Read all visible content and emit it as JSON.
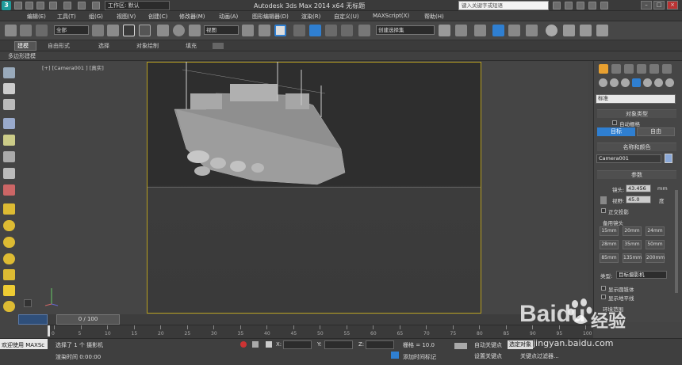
{
  "title_bar": {
    "workspace": "工作区: 默认",
    "title": "Autodesk 3ds Max  2014 x64      无标题",
    "search_placeholder": "键入关键字或短语"
  },
  "menus": [
    "编辑(E)",
    "工具(T)",
    "组(G)",
    "视图(V)",
    "创建(C)",
    "修改器(M)",
    "动画(A)",
    "图形编辑器(D)",
    "渲染(R)",
    "自定义(U)",
    "MAXScript(X)",
    "帮助(H)"
  ],
  "toolbar": {
    "selection_filter": "全部",
    "reference_coord": "视图",
    "named_selection": "创建选择集"
  },
  "ribbon": {
    "tabs": [
      "建模",
      "自由形式",
      "选择",
      "对象绘制",
      "填充"
    ],
    "sub_label": "多边形建模"
  },
  "viewport": {
    "label": "[+] [Camera001 ] [真实]"
  },
  "command_panel": {
    "category_dropdown": "标准",
    "object_type_title": "对象类型",
    "auto_grid": "自动栅格",
    "buttons": [
      "目标",
      "自由"
    ],
    "name_color_title": "名称和颜色",
    "object_name": "Camera001",
    "params_title": "参数",
    "lens_label": "镜头:",
    "lens_value": "43.456",
    "lens_unit": "mm",
    "fov_label": "视野:",
    "fov_value": "45.0",
    "fov_unit": "度",
    "ortho": "正交投影",
    "stock_lens_title": "备用镜头",
    "stock_lenses": [
      "15mm",
      "20mm",
      "24mm",
      "28mm",
      "35mm",
      "50mm",
      "85mm",
      "135mm",
      "200mm"
    ],
    "type_label": "类型:",
    "type_value": "目标摄影机",
    "show_cone": "显示圆锥体",
    "show_horizon": "显示地平线",
    "env_range": "环境范围"
  },
  "timeline": {
    "frame_counter": "0 / 100",
    "ticks": [
      "0",
      "5",
      "10",
      "15",
      "20",
      "25",
      "30",
      "35",
      "40",
      "45",
      "50",
      "55",
      "60",
      "65",
      "70",
      "75",
      "80",
      "85",
      "90",
      "95",
      "100"
    ]
  },
  "status": {
    "welcome": "欢迎使用 MAXSc",
    "selection_msg": "选择了 1 个 摄影机",
    "render_time": "渲染时间  0:00:00",
    "x_label": "X:",
    "y_label": "Y:",
    "z_label": "Z:",
    "grid": "栅格 = 10.0",
    "add_time_tag": "添加时间标记",
    "auto_key": "自动关键点",
    "set_key": "设置关键点",
    "selected": "选定对象",
    "key_filters": "关键点过滤器..."
  },
  "watermark": {
    "brand": "Baidu",
    "brand_cn": "经验",
    "url": "jingyan.baidu.com"
  },
  "colors": {
    "accent_blue": "#2f7fd1",
    "frame_gold": "#b8a020",
    "camera_swatch": "#8aa8d8"
  }
}
